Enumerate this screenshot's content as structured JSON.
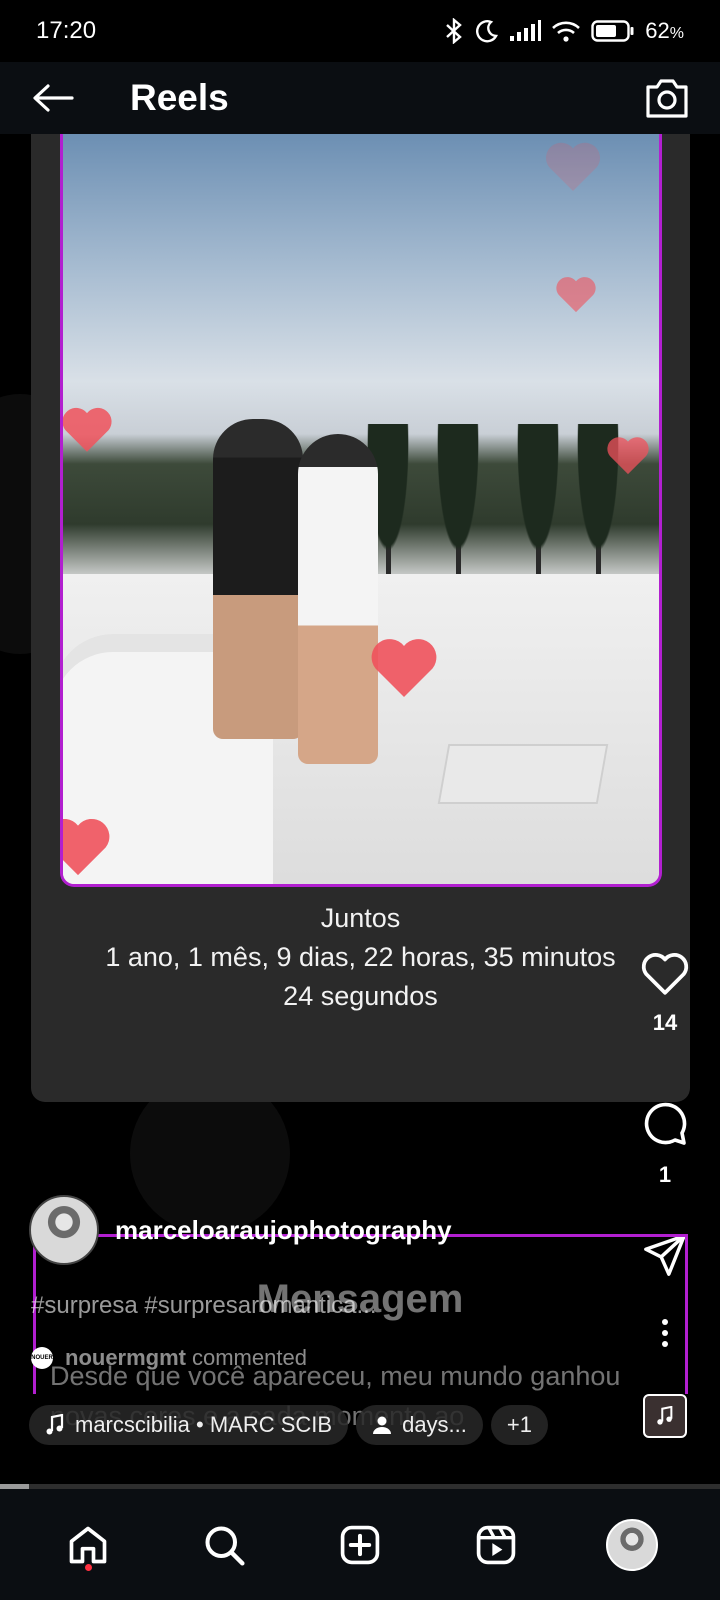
{
  "status_bar": {
    "time": "17:20",
    "battery": "62",
    "battery_unit": "%"
  },
  "header": {
    "title": "Reels",
    "back_icon": "arrow-left-icon",
    "camera_icon": "camera-icon"
  },
  "card": {
    "caption_line1": "Juntos",
    "caption_line2": "1 ano, 1 mês, 9 dias, 22 horas, 35 minutos",
    "caption_line3": "24 segundos"
  },
  "actions": {
    "likes": "14",
    "comments": "1"
  },
  "post": {
    "username": "marceloaraujophotography",
    "overlay_title": "Mensagem",
    "hashtags": "#surpresa #surpresaromantica...",
    "commenter_name": "nouermgmt",
    "commenter_action": "commented",
    "commenter_logo": "NOUER",
    "message": "Desde que você apareceu, meu mundo ganhou novas cores e a cada momento ao"
  },
  "pills": {
    "music": "marcscibilia • MARC SCIB",
    "people": "days...",
    "more": "+1"
  },
  "progress": {
    "fraction": 0.04
  },
  "colors": {
    "accent_border": "#b21fd0",
    "heart_red": "#f0525c",
    "notification_dot": "#ff3040"
  }
}
